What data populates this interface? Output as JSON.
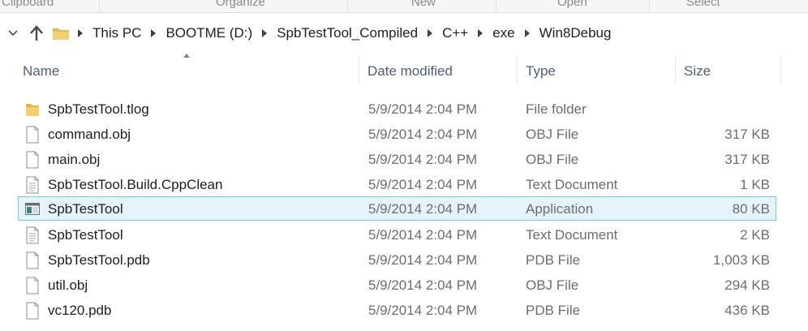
{
  "ribbon": {
    "groups": [
      "Clipboard",
      "Organize",
      "New",
      "Open",
      "Select"
    ]
  },
  "address_bar": {
    "breadcrumbs": [
      "This PC",
      "BOOTME (D:)",
      "SpbTestTool_Compiled",
      "C++",
      "exe",
      "Win8Debug"
    ]
  },
  "columns": {
    "name": "Name",
    "date": "Date modified",
    "type": "Type",
    "size": "Size"
  },
  "files": [
    {
      "name": "SpbTestTool.tlog",
      "date": "5/9/2014 2:04 PM",
      "type": "File folder",
      "size": "",
      "icon": "folder-icon"
    },
    {
      "name": "command.obj",
      "date": "5/9/2014 2:04 PM",
      "type": "OBJ File",
      "size": "317 KB",
      "icon": "file-icon"
    },
    {
      "name": "main.obj",
      "date": "5/9/2014 2:04 PM",
      "type": "OBJ File",
      "size": "317 KB",
      "icon": "file-icon"
    },
    {
      "name": "SpbTestTool.Build.CppClean",
      "date": "5/9/2014 2:04 PM",
      "type": "Text Document",
      "size": "1 KB",
      "icon": "text-file-icon"
    },
    {
      "name": "SpbTestTool",
      "date": "5/9/2014 2:04 PM",
      "type": "Application",
      "size": "80 KB",
      "icon": "application-icon",
      "selected": true
    },
    {
      "name": "SpbTestTool",
      "date": "5/9/2014 2:04 PM",
      "type": "Text Document",
      "size": "2 KB",
      "icon": "text-file-icon"
    },
    {
      "name": "SpbTestTool.pdb",
      "date": "5/9/2014 2:04 PM",
      "type": "PDB File",
      "size": "1,003 KB",
      "icon": "file-icon"
    },
    {
      "name": "util.obj",
      "date": "5/9/2014 2:04 PM",
      "type": "OBJ File",
      "size": "294 KB",
      "icon": "file-icon"
    },
    {
      "name": "vc120.pdb",
      "date": "5/9/2014 2:04 PM",
      "type": "PDB File",
      "size": "436 KB",
      "icon": "file-icon"
    }
  ],
  "colors": {
    "selection_bg": "#e5f3fb",
    "selection_border": "#7dc3e6",
    "header_text": "#4c607a",
    "folder": "#e8b84a"
  }
}
